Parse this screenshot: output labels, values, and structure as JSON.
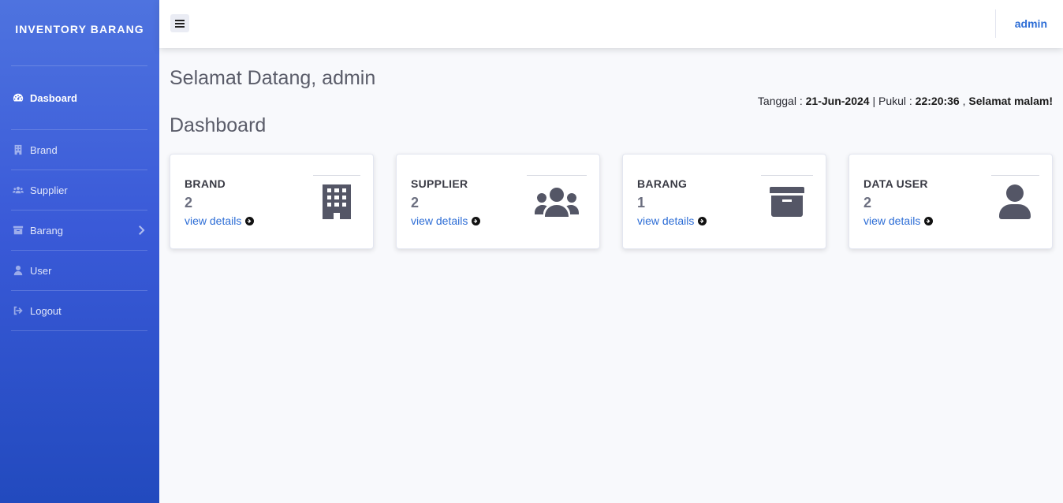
{
  "sidebar": {
    "brand": "INVENTORY BARANG",
    "items": [
      {
        "label": "Dasboard",
        "icon": "tachometer-icon"
      },
      {
        "label": "Brand",
        "icon": "building-icon"
      },
      {
        "label": "Supplier",
        "icon": "users-icon"
      },
      {
        "label": "Barang",
        "icon": "archive-icon"
      },
      {
        "label": "User",
        "icon": "user-icon"
      },
      {
        "label": "Logout",
        "icon": "sign-out-icon"
      }
    ]
  },
  "topbar": {
    "user": "admin"
  },
  "main": {
    "welcome": "Selamat Datang, admin",
    "datetime": {
      "date_label": "Tanggal : ",
      "date": "21-Jun-2024",
      "time_label": " | Pukul : ",
      "time": "22:20:36",
      "sep": " , ",
      "greeting": "Selamat malam!"
    },
    "title": "Dashboard",
    "cards": [
      {
        "label": "BRAND",
        "count": "2",
        "link": "view details",
        "icon": "building-icon"
      },
      {
        "label": "SUPPLIER",
        "count": "2",
        "link": "view details",
        "icon": "users-icon"
      },
      {
        "label": "BARANG",
        "count": "1",
        "link": "view details",
        "icon": "archive-icon"
      },
      {
        "label": "DATA USER",
        "count": "2",
        "link": "view details",
        "icon": "user-icon"
      }
    ]
  },
  "colors": {
    "sidebar_top": "#4e73df",
    "sidebar_bottom": "#224abe",
    "link": "#2e6ed6",
    "icon": "#545666"
  }
}
